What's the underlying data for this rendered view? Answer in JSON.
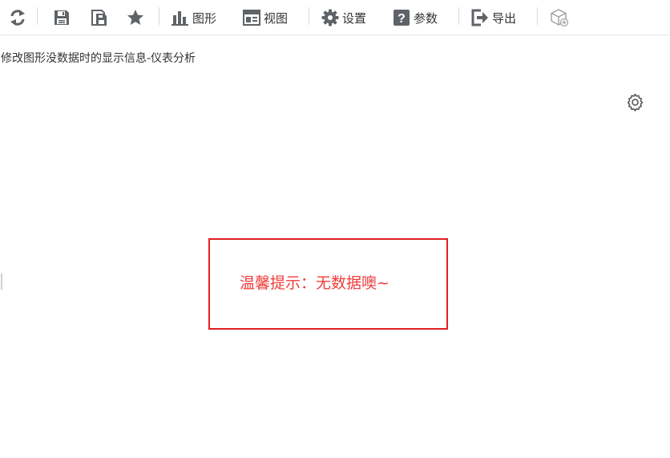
{
  "toolbar": {
    "refresh_icon": "refresh-icon",
    "save_icon": "save-icon",
    "save_as_icon": "save-as-icon",
    "favorite_icon": "star-icon",
    "chart_label": "图形",
    "view_label": "视图",
    "settings_label": "设置",
    "params_label": "参数",
    "export_label": "导出",
    "cube_icon": "cube-link-icon"
  },
  "report": {
    "title": "修改图形没数据时的显示信息-仪表分析",
    "settings_icon": "gear-icon"
  },
  "empty_state": {
    "message": "温馨提示：无数据噢~"
  },
  "colors": {
    "icon": "#5f6368",
    "text": "#333333",
    "alert_text": "#f03c3c",
    "alert_border": "#e02020",
    "separator": "#d9d9d9"
  }
}
